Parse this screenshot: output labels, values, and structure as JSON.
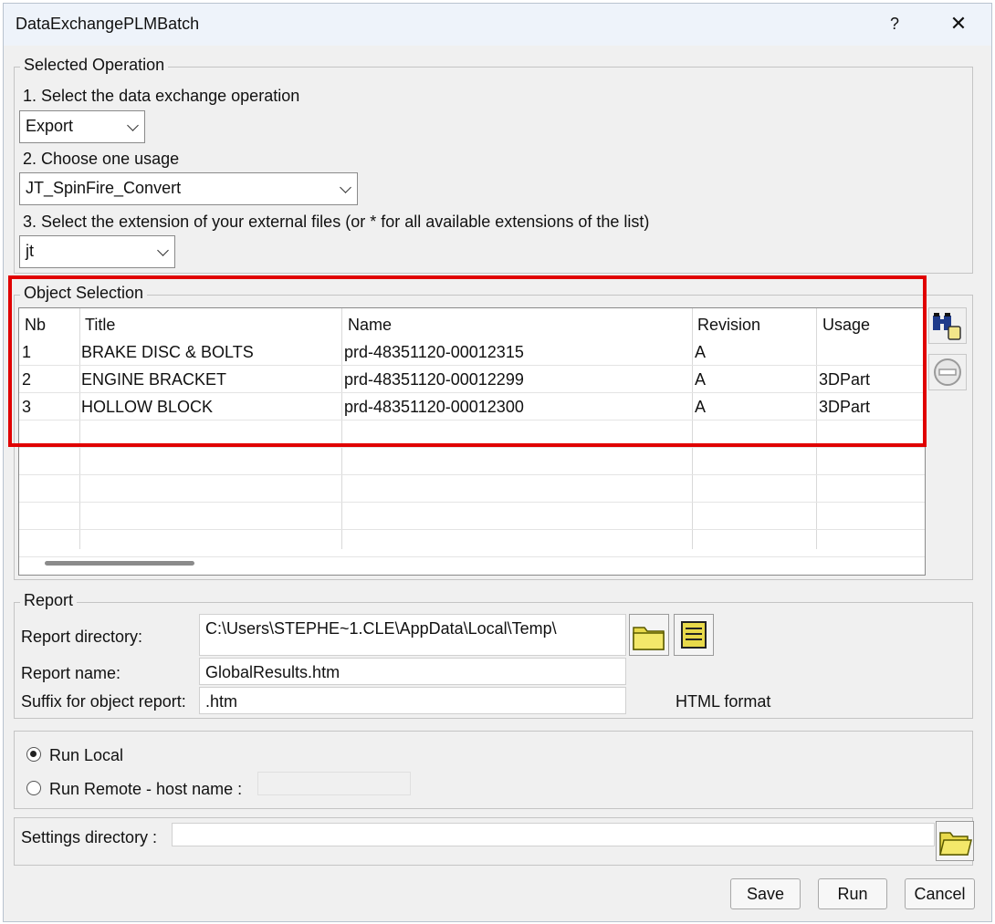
{
  "window": {
    "title": "DataExchangePLMBatch",
    "help": "?",
    "close": "✕"
  },
  "selected_operation": {
    "legend": "Selected Operation",
    "step1_label": "1. Select the data exchange operation",
    "operation_value": "Export",
    "step2_label": "2. Choose one usage",
    "usage_value": "JT_SpinFire_Convert",
    "step3_label": "3. Select the extension of your external files (or * for all available extensions of the list)",
    "extension_value": "jt"
  },
  "object_selection": {
    "legend": "Object Selection",
    "columns": [
      "Nb",
      "Title",
      "Name",
      "Revision",
      "Usage"
    ],
    "rows": [
      [
        "1",
        "BRAKE DISC & BOLTS",
        "prd-48351120-00012315",
        "A",
        ""
      ],
      [
        "2",
        "ENGINE BRACKET",
        "prd-48351120-00012299",
        "A",
        "3DPart"
      ],
      [
        "3",
        "HOLLOW BLOCK",
        "prd-48351120-00012300",
        "A",
        "3DPart"
      ]
    ]
  },
  "report": {
    "legend": "Report",
    "dir_label": "Report directory:",
    "dir_value": "C:\\Users\\STEPHE~1.CLE\\AppData\\Local\\Temp\\",
    "name_label": "Report name:",
    "name_value": "GlobalResults.htm",
    "suffix_label": "Suffix for object report:",
    "suffix_value": ".htm",
    "format_label": "HTML format"
  },
  "run_mode": {
    "local_label": "Run Local",
    "remote_label": "Run Remote - host name :",
    "remote_host": "",
    "selected": "local"
  },
  "settings": {
    "label": "Settings directory :",
    "value": ""
  },
  "buttons": {
    "save": "Save",
    "run": "Run",
    "cancel": "Cancel"
  },
  "colors": {
    "highlight": "#e00000",
    "folder": "#e8d94a"
  }
}
